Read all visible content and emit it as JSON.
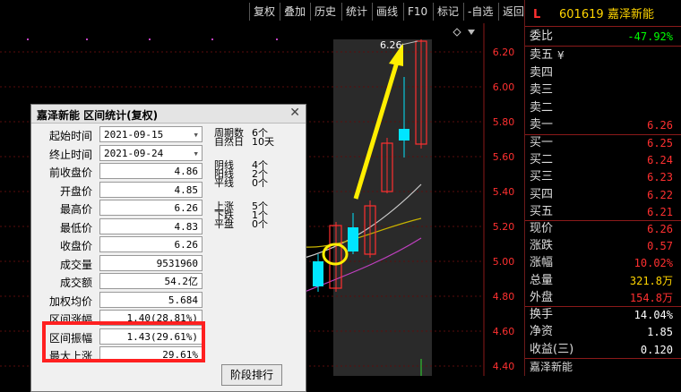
{
  "toolbar": {
    "buttons": [
      "复权",
      "叠加",
      "历史",
      "统计",
      "画线",
      "F10",
      "标记",
      "-自选",
      "返回"
    ]
  },
  "chart": {
    "axis_ticks": [
      "6.20",
      "6.00",
      "5.80",
      "5.60",
      "5.40",
      "5.20",
      "5.00",
      "4.80",
      "4.60",
      "4.40"
    ],
    "peak_label": "6.26"
  },
  "quote": {
    "marker": "L",
    "code": "601619",
    "name": "嘉泽新能",
    "webi_label": "委比",
    "webi_value": "-47.92%",
    "sell": [
      {
        "label": "卖五",
        "price": "",
        "extra": "¥"
      },
      {
        "label": "卖四",
        "price": ""
      },
      {
        "label": "卖三",
        "price": ""
      },
      {
        "label": "卖二",
        "price": ""
      },
      {
        "label": "卖一",
        "price": "6.26"
      }
    ],
    "buy": [
      {
        "label": "买一",
        "price": "6.25"
      },
      {
        "label": "买二",
        "price": "6.24"
      },
      {
        "label": "买三",
        "price": "6.23"
      },
      {
        "label": "买四",
        "price": "6.22"
      },
      {
        "label": "买五",
        "price": "6.21"
      }
    ],
    "stats": [
      {
        "label": "现价",
        "value": "6.26"
      },
      {
        "label": "涨跌",
        "value": "0.57"
      },
      {
        "label": "涨幅",
        "value": "10.02%"
      },
      {
        "label": "总量",
        "value": "321.8万"
      },
      {
        "label": "外盘",
        "value": "154.8万"
      }
    ],
    "stats2": [
      {
        "label": "换手",
        "value": "14.04%"
      },
      {
        "label": "净资",
        "value": "1.85"
      },
      {
        "label": "收益(三)",
        "value": "0.120"
      }
    ],
    "footer_name": "嘉泽新能"
  },
  "dialog": {
    "title": "嘉泽新能 区间统计(复权)",
    "close": "✕",
    "fields": [
      {
        "label": "起始时间",
        "value": "2021-09-15",
        "dropdown": true
      },
      {
        "label": "终止时间",
        "value": "2021-09-24",
        "dropdown": true
      },
      {
        "label": "前收盘价",
        "value": "4.86"
      },
      {
        "label": "开盘价",
        "value": "4.85"
      },
      {
        "label": "最高价",
        "value": "6.26"
      },
      {
        "label": "最低价",
        "value": "4.83"
      },
      {
        "label": "收盘价",
        "value": "6.26"
      },
      {
        "label": "成交量",
        "value": "9531960"
      },
      {
        "label": "成交额",
        "value": "54.2亿"
      },
      {
        "label": "加权均价",
        "value": "5.684"
      },
      {
        "label": "区间涨幅",
        "value": "1.40(28.81%)"
      },
      {
        "label": "区间振幅",
        "value": "1.43(29.61%)"
      },
      {
        "label": "最大上涨",
        "value": "29.61%"
      }
    ],
    "period": [
      {
        "label": "周期数",
        "value": "6个"
      },
      {
        "label": "自然日",
        "value": "10天"
      }
    ],
    "lines": [
      {
        "label": "阴线",
        "value": "4个"
      },
      {
        "label": "阳线",
        "value": "2个"
      },
      {
        "label": "平线",
        "value": "0个"
      }
    ],
    "moves": [
      {
        "label": "上涨",
        "value": "5个"
      },
      {
        "label": "下跌",
        "value": "1个"
      },
      {
        "label": "平盘",
        "value": "0个"
      }
    ],
    "rank_button": "阶段排行"
  }
}
